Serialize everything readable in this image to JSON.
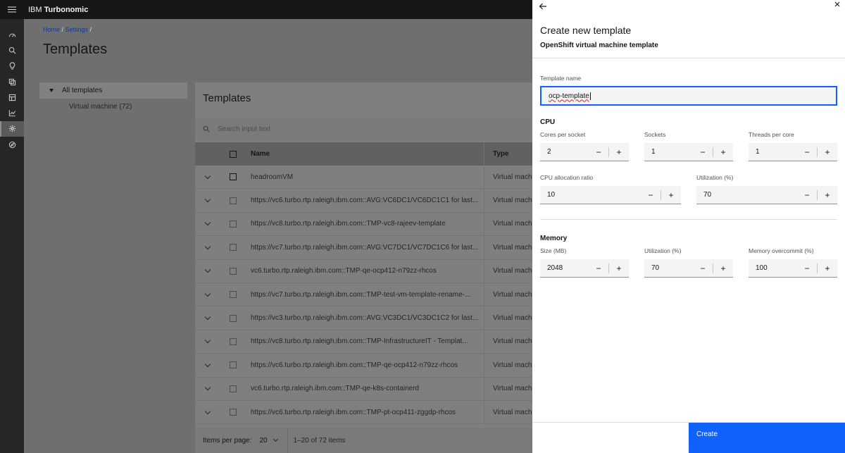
{
  "header": {
    "brand_prefix": "IBM",
    "brand_name": "Turbonomic"
  },
  "rail": [
    "dashboard-icon",
    "search-icon",
    "lightbulb-icon",
    "copy-icon",
    "table-icon",
    "chart-icon",
    "gear-icon",
    "compass-icon"
  ],
  "breadcrumb": {
    "home": "Home",
    "sep1": " / ",
    "settings": "Settings",
    "sep2": " /"
  },
  "page": {
    "title": "Templates"
  },
  "tree": {
    "all": "All templates",
    "vm": "Virtual machine (72)"
  },
  "list": {
    "title": "Templates",
    "search_placeholder": "Search input text",
    "columns": {
      "name": "Name",
      "type": "Type"
    },
    "rows": [
      {
        "name": "headroomVM",
        "type": "Virtual machine"
      },
      {
        "name": "https://vc6.turbo.rtp.raleigh.ibm.com::AVG:VC6DC1/VC6DC1C1 for last...",
        "type": "Virtual machine"
      },
      {
        "name": "https://vc8.turbo.rtp.raleigh.ibm.com::TMP-vc8-rajeev-template",
        "type": "Virtual machine"
      },
      {
        "name": "https://vc7.turbo.rtp.raleigh.ibm.com::AVG:VC7DC1/VC7DC1C6 for last...",
        "type": "Virtual machine"
      },
      {
        "name": "vc6.turbo.rtp.raleigh.ibm.com::TMP-qe-ocp412-n79zz-rhcos",
        "type": "Virtual machine"
      },
      {
        "name": "https://vc7.turbo.rtp.raleigh.ibm.com::TMP-test-vm-template-rename-...",
        "type": "Virtual machine"
      },
      {
        "name": "https://vc3.turbo.rtp.raleigh.ibm.com::AVG:VC3DC1/VC3DC1C2 for last...",
        "type": "Virtual machine"
      },
      {
        "name": "https://vc8.turbo.rtp.raleigh.ibm.com::TMP-InfrastructureIT - Templat...",
        "type": "Virtual machine"
      },
      {
        "name": "https://vc6.turbo.rtp.raleigh.ibm.com::TMP-qe-ocp412-n79zz-rhcos",
        "type": "Virtual machine"
      },
      {
        "name": "vc6.turbo.rtp.raleigh.ibm.com::TMP-qe-k8s-containerd",
        "type": "Virtual machine"
      },
      {
        "name": "https://vc6.turbo.rtp.raleigh.ibm.com::TMP-pt-ocp411-zggdp-rhcos",
        "type": "Virtual machine"
      }
    ],
    "pager": {
      "items_per_page_label": "Items per page:",
      "items_per_page": "20",
      "range": "1–20 of 72 items"
    }
  },
  "panel": {
    "title": "Create new template",
    "subtitle": "OpenShift virtual machine template",
    "template_name_label": "Template name",
    "template_name_value": "ocp-template",
    "cpu": {
      "heading": "CPU",
      "cores_label": "Cores per socket",
      "cores_value": "2",
      "sockets_label": "Sockets",
      "sockets_value": "1",
      "threads_label": "Threads per core",
      "threads_value": "1",
      "ratio_label": "CPU allocation ratio",
      "ratio_value": "10",
      "util_label": "Utilization (%)",
      "util_value": "70"
    },
    "memory": {
      "heading": "Memory",
      "size_label": "Size (MB)",
      "size_value": "2048",
      "util_label": "Utilization (%)",
      "util_value": "70",
      "overcommit_label": "Memory overcommit (%)",
      "overcommit_value": "100"
    },
    "minus": "−",
    "plus": "+",
    "create_label": "Create"
  }
}
